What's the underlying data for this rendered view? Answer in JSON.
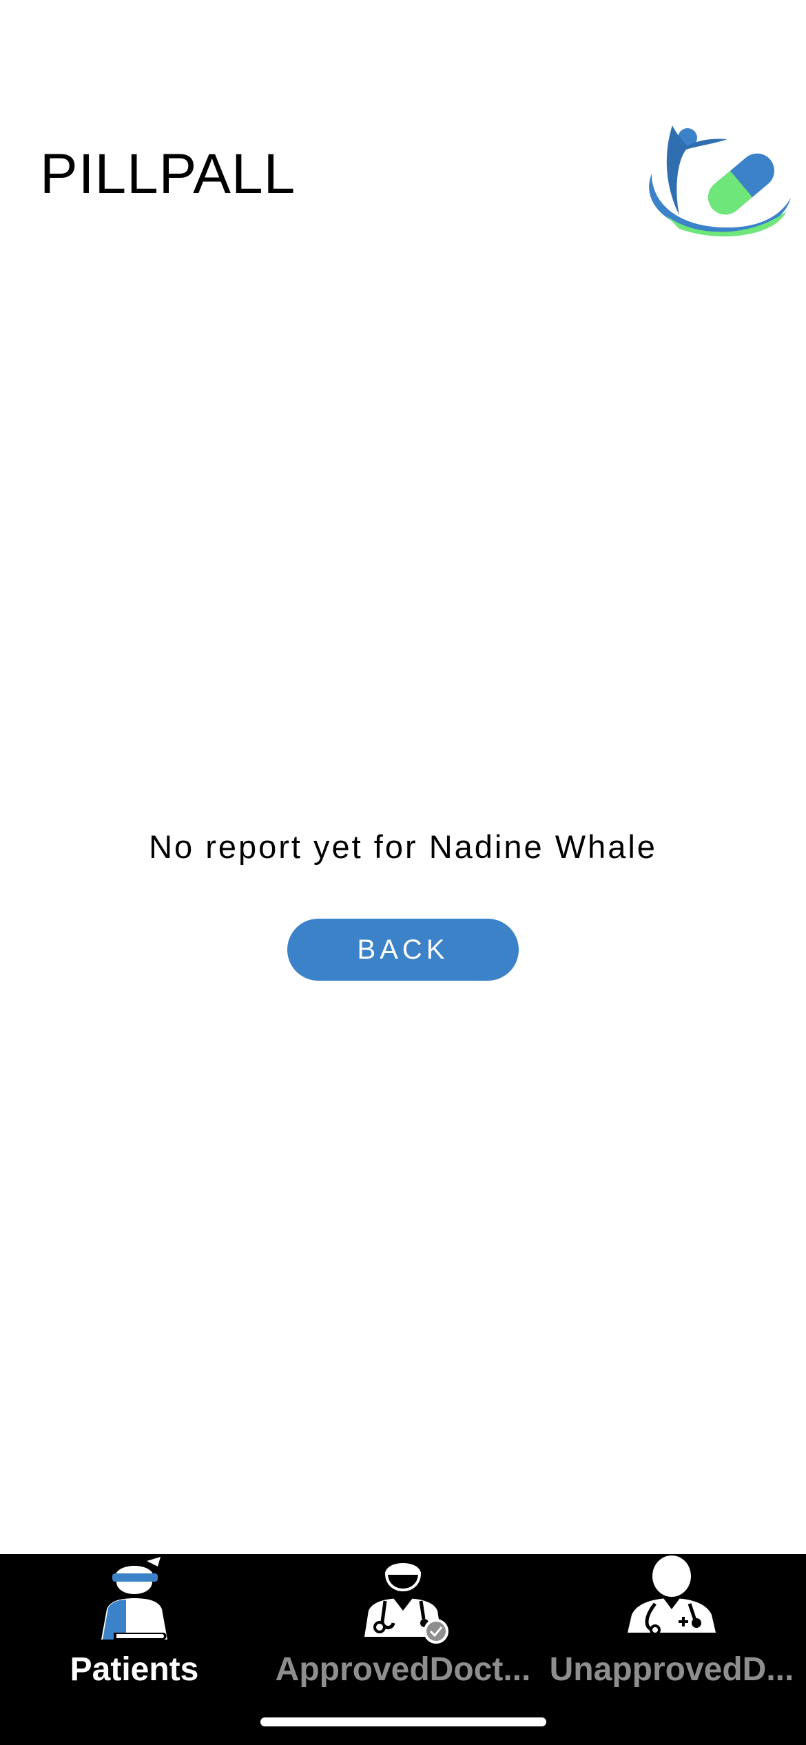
{
  "app": {
    "title": "PILLPALL",
    "logo_icon": "pill-capsule-person-logo-icon"
  },
  "main": {
    "message": "No report yet for Nadine Whale",
    "back_label": "BACK"
  },
  "tabs": [
    {
      "label": "Patients",
      "icon": "patient-icon",
      "active": true
    },
    {
      "label": "ApprovedDoct...",
      "icon": "approved-doctor-icon",
      "active": false
    },
    {
      "label": "UnapprovedD...",
      "icon": "unapproved-doctor-icon",
      "active": false
    }
  ],
  "colors": {
    "accent": "#3b82c8",
    "logo_green": "#6ee67a",
    "tab_active": "#ffffff",
    "tab_inactive": "#8e8e8e",
    "tabbar_bg": "#000000"
  }
}
